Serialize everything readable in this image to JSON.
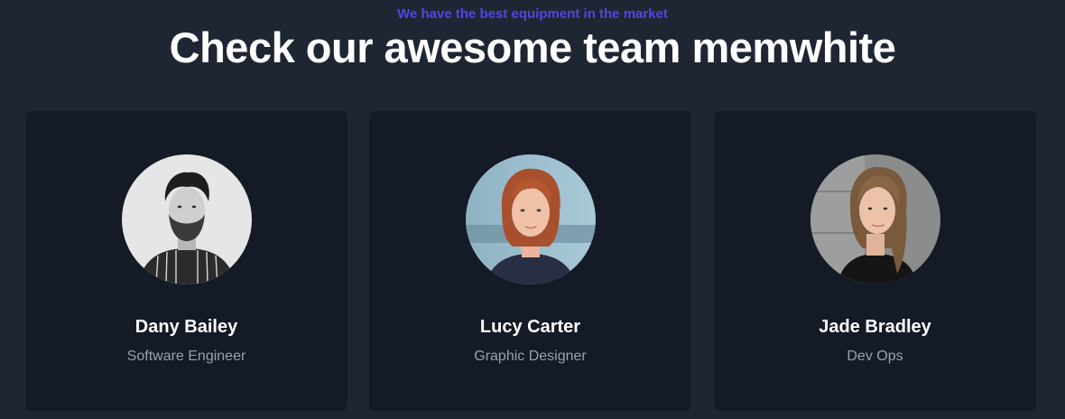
{
  "header": {
    "subtitle": "We have the best equipment in the market",
    "title": "Check our awesome team memwhite",
    "subtitle_color": "#4f46e5"
  },
  "team": [
    {
      "name": "Dany Bailey",
      "role": "Software Engineer"
    },
    {
      "name": "Lucy Carter",
      "role": "Graphic Designer"
    },
    {
      "name": "Jade Bradley",
      "role": "Dev Ops"
    }
  ]
}
